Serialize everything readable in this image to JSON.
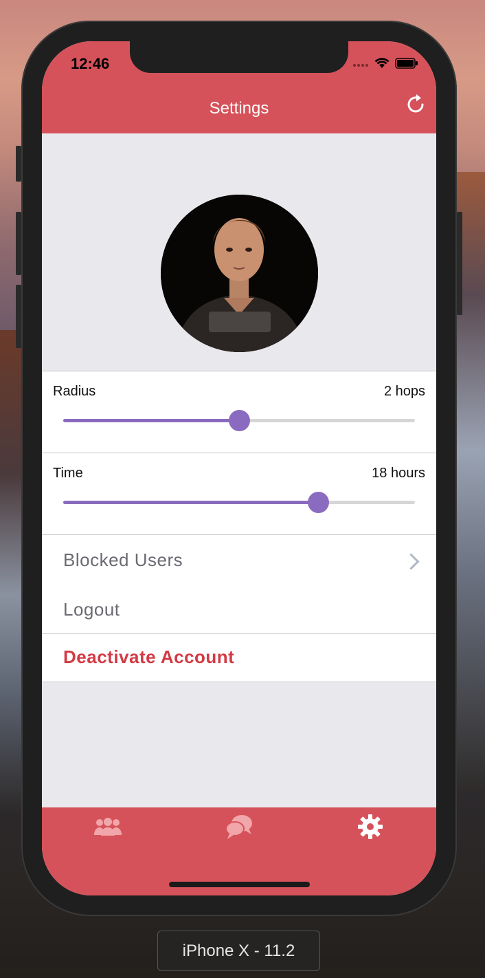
{
  "status_bar": {
    "time": "12:46"
  },
  "navbar": {
    "title": "Settings",
    "refresh_icon": "refresh-icon"
  },
  "profile": {
    "avatar_alt": "profile photo"
  },
  "sliders": [
    {
      "label": "Radius",
      "value_text": "2 hops",
      "fraction": 0.5
    },
    {
      "label": "Time",
      "value_text": "18 hours",
      "fraction": 0.725
    }
  ],
  "menu": {
    "blocked_users": "Blocked Users",
    "logout": "Logout",
    "deactivate": "Deactivate Account"
  },
  "tabbar": {
    "tabs": [
      {
        "icon": "users-icon",
        "active": false
      },
      {
        "icon": "chat-icon",
        "active": false
      },
      {
        "icon": "gear-icon",
        "active": true
      }
    ]
  },
  "simulator": {
    "device_label": "iPhone X - 11.2"
  },
  "colors": {
    "accent": "#d6525a",
    "slider": "#8a6bbf",
    "danger": "#d33a44"
  }
}
